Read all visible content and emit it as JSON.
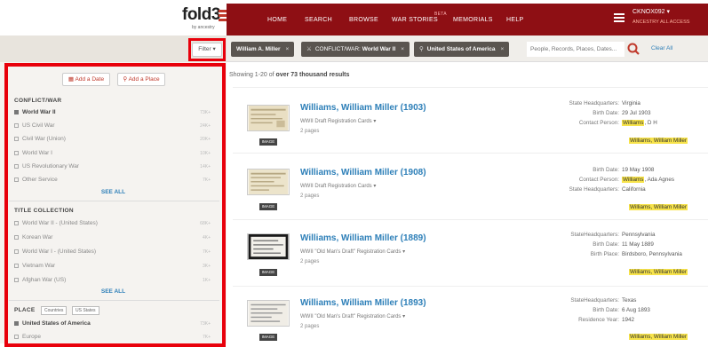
{
  "nav": {
    "logo": "fold3",
    "logo_sub": "by ancestry",
    "links": [
      "HOME",
      "SEARCH",
      "BROWSE",
      "WAR STORIES",
      "MEMORIALS",
      "HELP"
    ],
    "beta": "BETA",
    "user": "CKNOX092 ▾",
    "user_sub": "ANCESTRY ALL ACCESS",
    "brand_color": "#8e0f14"
  },
  "search": {
    "filter_label": "Filter ▾",
    "chips": [
      {
        "label": "William A. Miller",
        "close": "×"
      },
      {
        "prefix": "CONFLICT/WAR:",
        "label": "World War II",
        "close": "×"
      },
      {
        "label": "United States of America",
        "close": "×"
      }
    ],
    "placeholder": "People, Records, Places, Dates...",
    "clear_all": "Clear All"
  },
  "sidebar": {
    "add_date": "Add a Date",
    "add_place": "Add a Place",
    "sections": [
      {
        "title": "CONFLICT/WAR",
        "items": [
          {
            "label": "World War II",
            "count": "73K+",
            "checked": true
          },
          {
            "label": "US Civil War",
            "count": "24K+",
            "checked": false
          },
          {
            "label": "Civil War (Union)",
            "count": "20K+",
            "checked": false
          },
          {
            "label": "World War I",
            "count": "10K+",
            "checked": false
          },
          {
            "label": "US Revolutionary War",
            "count": "14K+",
            "checked": false
          },
          {
            "label": "Other Service",
            "count": "7K+",
            "checked": false
          }
        ],
        "see_all": "SEE ALL"
      },
      {
        "title": "TITLE COLLECTION",
        "items": [
          {
            "label": "World War II - (United States)",
            "count": "68K+",
            "checked": false
          },
          {
            "label": "Korean War",
            "count": "4K+",
            "checked": false
          },
          {
            "label": "World War I - (United States)",
            "count": "7K+",
            "checked": false
          },
          {
            "label": "Vietnam War",
            "count": "3K+",
            "checked": false
          },
          {
            "label": "Afghan War (US)",
            "count": "1K+",
            "checked": false
          }
        ],
        "see_all": "SEE ALL"
      },
      {
        "title": "PLACE",
        "tabs": [
          "Countries",
          "US States"
        ],
        "items": [
          {
            "label": "United States of America",
            "count": "73K+",
            "checked": true
          },
          {
            "label": "Europe",
            "count": "7K+",
            "checked": false
          }
        ]
      }
    ]
  },
  "results": {
    "count_prefix": "Showing 1-20 of",
    "count_bold": "over 73 thousand results",
    "image_label": "IMAGE",
    "records": [
      {
        "title": "Williams, William Miller (1903)",
        "collection": "WWII Draft Registration Cards ▾",
        "pages": "2 pages",
        "facts": [
          {
            "k": "State Headquarters:",
            "v": "Virginia"
          },
          {
            "k": "Birth Date:",
            "v": "29 Jul 1903"
          },
          {
            "k": "Contact Person:",
            "v_hl": "Williams",
            "v": ", D H"
          }
        ],
        "name_tag": "Williams, William Miller"
      },
      {
        "title": "Williams, William Miller (1908)",
        "collection": "WWII Draft Registration Cards ▾",
        "pages": "2 pages",
        "facts": [
          {
            "k": "Birth Date:",
            "v": "19 May 1908"
          },
          {
            "k": "Contact Person:",
            "v_hl": "Williams",
            "v": ", Ada Agnes"
          },
          {
            "k": "State Headquarters:",
            "v": "California"
          }
        ],
        "name_tag": "Williams, William Miller"
      },
      {
        "title": "Williams, William Miller (1889)",
        "collection": "WWII \"Old Man's Draft\" Registration Cards ▾",
        "pages": "2 pages",
        "facts": [
          {
            "k": "StateHeadquarters:",
            "v": "Pennsylvania"
          },
          {
            "k": "Birth Date:",
            "v": "11 May 1889"
          },
          {
            "k": "Birth Place:",
            "v": "Birdsboro, Pennsylvania"
          }
        ],
        "name_tag": "Williams, William Miller"
      },
      {
        "title": "Williams, William Miller (1893)",
        "collection": "WWII \"Old Man's Draft\" Registration Cards ▾",
        "pages": "2 pages",
        "facts": [
          {
            "k": "StateHeadquarters:",
            "v": "Texas"
          },
          {
            "k": "Birth Date:",
            "v": "6 Aug 1893"
          },
          {
            "k": "Residence Year:",
            "v": "1942"
          }
        ],
        "name_tag": "Williams, William Miller"
      }
    ]
  }
}
